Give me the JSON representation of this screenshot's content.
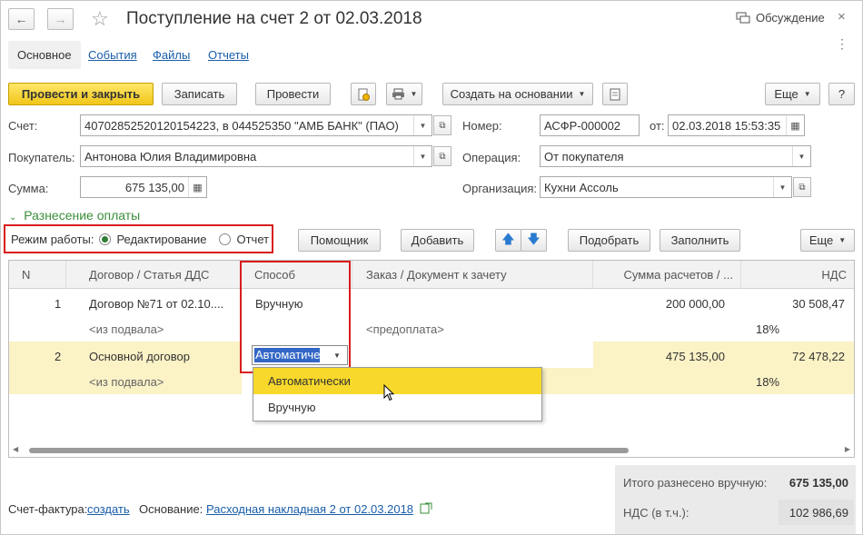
{
  "window": {
    "title": "Поступление на счет 2 от 02.03.2018",
    "discussion_label": "Обсуждение"
  },
  "tabs": [
    "Основное",
    "События",
    "Файлы",
    "Отчеты"
  ],
  "toolbar": {
    "post_close": "Провести и закрыть",
    "save": "Записать",
    "post": "Провести",
    "create_based": "Создать на основании",
    "more": "Еще",
    "help": "?"
  },
  "form": {
    "account_label": "Счет:",
    "account_value": "40702852520120154223, в 044525350 \"АМБ БАНК\" (ПАО)",
    "number_label": "Номер:",
    "number_value": "АСФР-000002",
    "date_label": "от:",
    "date_value": "02.03.2018 15:53:35",
    "buyer_label": "Покупатель:",
    "buyer_value": "Антонова Юлия Владимировна",
    "operation_label": "Операция:",
    "operation_value": "От покупателя",
    "sum_label": "Сумма:",
    "sum_value": "675 135,00",
    "org_label": "Организация:",
    "org_value": "Кухни Ассоль"
  },
  "allocation": {
    "section_title": "Разнесение оплаты",
    "mode_label": "Режим работы:",
    "mode_edit": "Редактирование",
    "mode_report": "Отчет",
    "assistant": "Помощник",
    "add": "Добавить",
    "select": "Подобрать",
    "fill": "Заполнить",
    "more": "Еще"
  },
  "table": {
    "headers": [
      "N",
      "Договор / Статья ДДС",
      "Способ",
      "Заказ / Документ к зачету",
      "Сумма расчетов / ...",
      "НДС"
    ],
    "rows": [
      {
        "n": "1",
        "contract": "Договор №71 от 02.10....",
        "sub": "<из подвала>",
        "method": "Вручную",
        "order_sub": "<предоплата>",
        "amount": "200 000,00",
        "vat": "30 508,47",
        "vat_rate": "18%"
      },
      {
        "n": "2",
        "contract": "Основной договор",
        "sub": "<из подвала>",
        "method": "Автоматиче",
        "amount": "475 135,00",
        "vat": "72 478,22",
        "vat_rate": "18%"
      }
    ]
  },
  "dropdown": {
    "options": [
      "Автоматически",
      "Вручную"
    ],
    "selected_index": 0
  },
  "footer": {
    "invoice_label": "Счет-фактура:",
    "invoice_link": "создать",
    "basis_label": "Основание:",
    "basis_link": "Расходная накладная 2 от 02.03.2018",
    "total_manual_label": "Итого разнесено вручную:",
    "total_manual_value": "675 135,00",
    "vat_incl_label": "НДС (в т.ч.):",
    "vat_incl_value": "102 986,69"
  },
  "colors": {
    "primary_button": "#f1c61a",
    "selected_row": "#fbf2c6",
    "highlight_frame": "#d81e1e",
    "link": "#1a5ea8",
    "section_title": "#3a8f3a"
  }
}
